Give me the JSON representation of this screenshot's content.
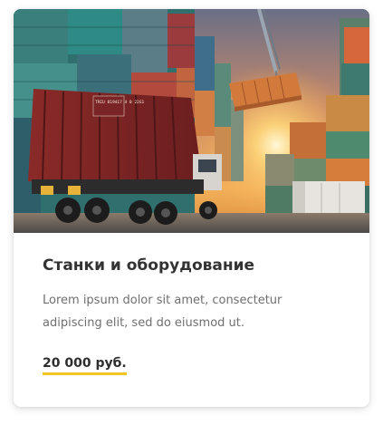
{
  "card": {
    "image_alt": "Контейнерный терминал с грузовиком и поднимаемым краном контейнером на закате",
    "title": "Станки и оборудование",
    "description": "Lorem ipsum dolor sit amet, consectetur adipiscing elit, sed do eiusmod ut.",
    "price": "20 000 руб.",
    "truck_panel_text": "TRIU 819417 4 0 22G1"
  },
  "colors": {
    "accent_underline": "#f3c523",
    "title": "#333333",
    "description": "#6f6f6f",
    "price": "#2e2e2e"
  }
}
